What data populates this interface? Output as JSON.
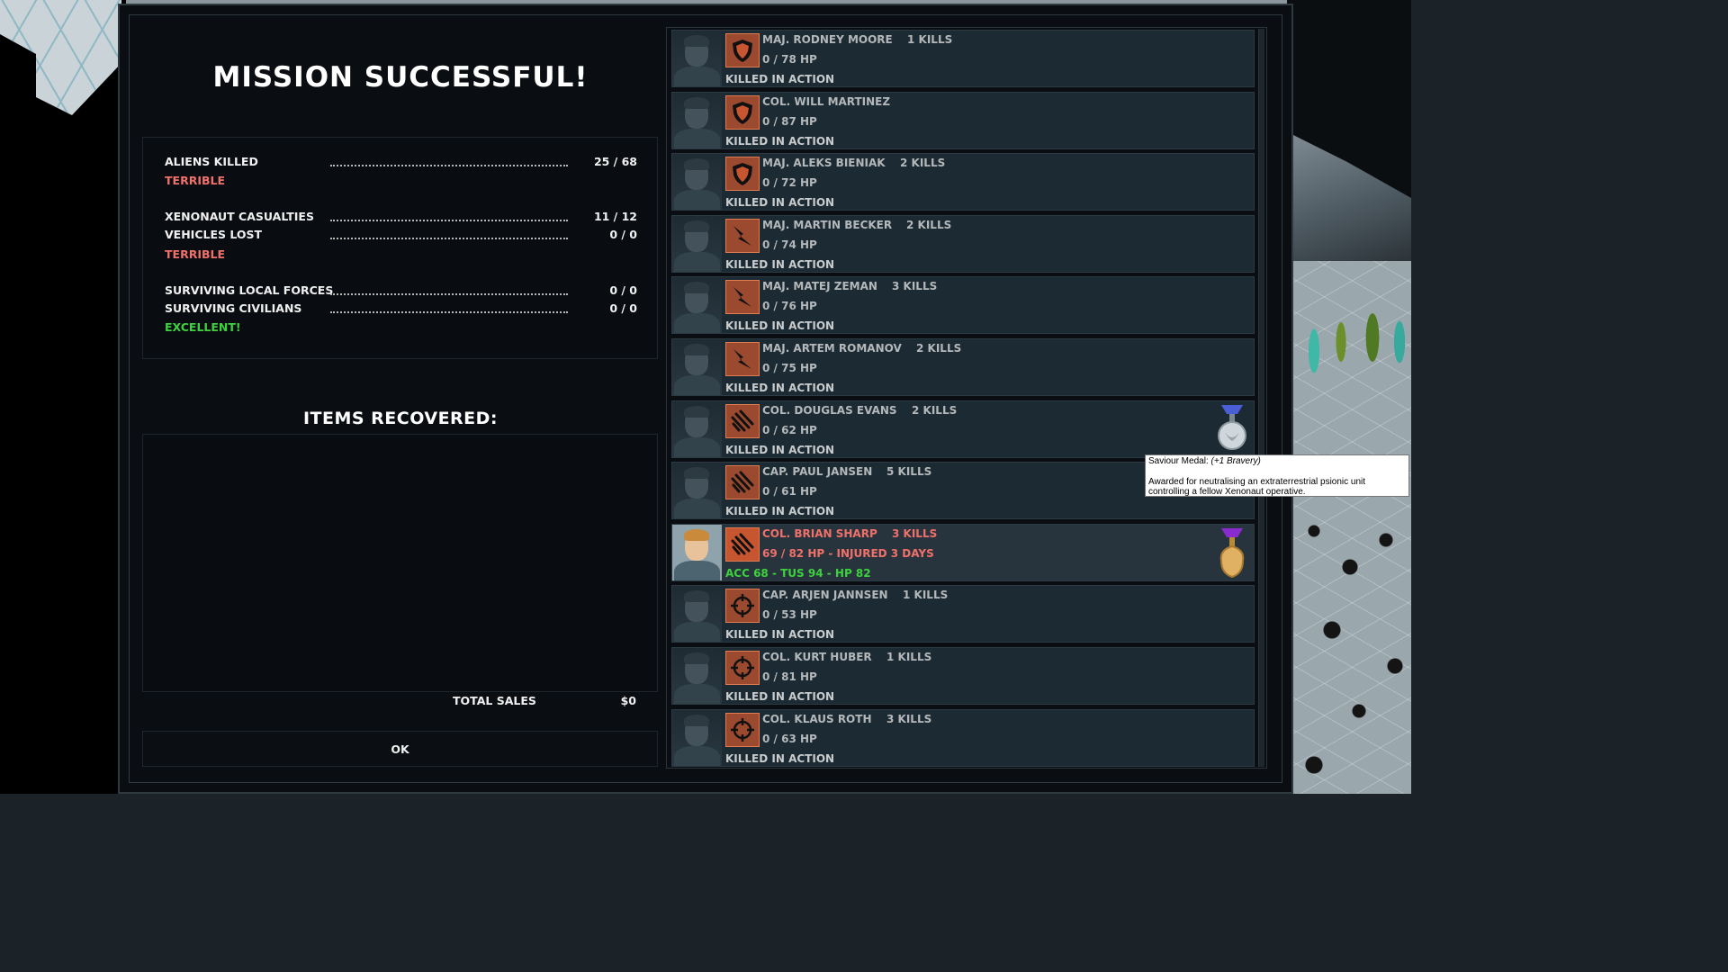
{
  "title": "MISSION SUCCESSFUL!",
  "stats": {
    "aliens_killed": {
      "label": "ALIENS KILLED",
      "value": "25 / 68"
    },
    "aliens_rating": "TERRIBLE",
    "casualties": {
      "label": "XENONAUT CASUALTIES",
      "value": "11 / 12"
    },
    "vehicles": {
      "label": "VEHICLES LOST",
      "value": "0 / 0"
    },
    "casualties_rating": "TERRIBLE",
    "local_forces": {
      "label": "SURVIVING LOCAL FORCES",
      "value": "0 / 0"
    },
    "civilians": {
      "label": "SURVIVING CIVILIANS",
      "value": "0 / 0"
    },
    "civilians_rating": "EXCELLENT!"
  },
  "items": {
    "title": "ITEMS RECOVERED:",
    "total_label": "TOTAL SALES",
    "total_value": "$0"
  },
  "ok_label": "OK",
  "soldiers": [
    {
      "name": "MAJ. RODNEY MOORE",
      "kills": "1 KILLS",
      "hp": "0 / 78 HP",
      "status": "KILLED IN ACTION",
      "icon": "shield-icon"
    },
    {
      "name": "COL. WILL MARTINEZ",
      "kills": "",
      "hp": "0 / 87 HP",
      "status": "KILLED IN ACTION",
      "icon": "shield-icon"
    },
    {
      "name": "MAJ. ALEKS BIENIAK",
      "kills": "2 KILLS",
      "hp": "0 / 72 HP",
      "status": "KILLED IN ACTION",
      "icon": "shield-icon"
    },
    {
      "name": "MAJ. MARTIN BECKER",
      "kills": "2 KILLS",
      "hp": "0 / 74 HP",
      "status": "KILLED IN ACTION",
      "icon": "lightning-icon"
    },
    {
      "name": "MAJ. MATEJ ZEMAN",
      "kills": "3 KILLS",
      "hp": "0 / 76 HP",
      "status": "KILLED IN ACTION",
      "icon": "lightning-icon"
    },
    {
      "name": "MAJ. ARTEM ROMANOV",
      "kills": "2 KILLS",
      "hp": "0 / 75 HP",
      "status": "KILLED IN ACTION",
      "icon": "lightning-icon"
    },
    {
      "name": "COL. DOUGLAS EVANS",
      "kills": "2 KILLS",
      "hp": "0 / 62 HP",
      "status": "KILLED IN ACTION",
      "icon": "claw-icon",
      "medal": "silver-medal-icon"
    },
    {
      "name": "CAP. PAUL JANSEN",
      "kills": "5 KILLS",
      "hp": "0 / 61 HP",
      "status": "KILLED IN ACTION",
      "icon": "claw-icon"
    },
    {
      "name": "COL. BRIAN SHARP",
      "kills": "3 KILLS",
      "hp": "69 / 82 HP - INJURED 3 DAYS",
      "status": "ACC 68  -  TUS 94  -  HP 82",
      "icon": "claw-icon",
      "medal": "gold-medal-icon",
      "active": true
    },
    {
      "name": "CAP. ARJEN JANNSEN",
      "kills": "1 KILLS",
      "hp": "0 / 53 HP",
      "status": "KILLED IN ACTION",
      "icon": "crosshair-icon"
    },
    {
      "name": "COL. KURT HUBER",
      "kills": "1 KILLS",
      "hp": "0 / 81 HP",
      "status": "KILLED IN ACTION",
      "icon": "crosshair-icon"
    },
    {
      "name": "COL. KLAUS ROTH",
      "kills": "3 KILLS",
      "hp": "0 / 63 HP",
      "status": "KILLED IN ACTION",
      "icon": "crosshair-icon"
    }
  ],
  "tooltip": {
    "title": "Saviour Medal:",
    "subtitle": "(+1 Bravery)",
    "description": "Awarded for neutralising an extraterrestrial psionic unit controlling a fellow Xenonaut operative."
  },
  "colors": {
    "rating_bad": "#f0706a",
    "rating_good": "#3dd23d",
    "class_icon": "#c7552f"
  }
}
